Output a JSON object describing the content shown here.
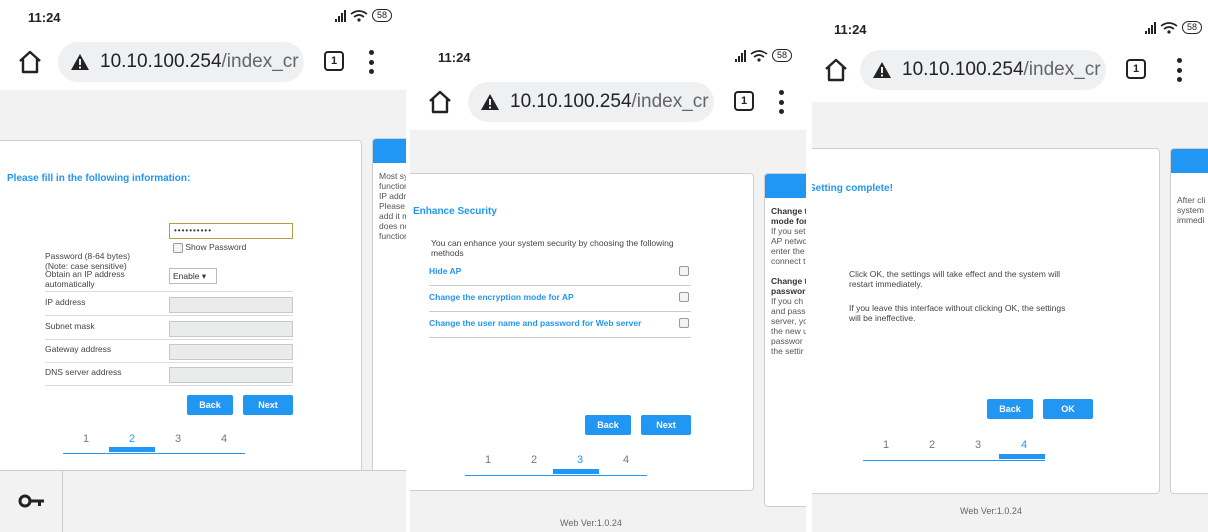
{
  "status": {
    "time": "11:24",
    "battery": "58"
  },
  "browser": {
    "url_host": "10.10.100.254",
    "url_rest": "/index_cr",
    "tab_count": "1"
  },
  "footer": {
    "version": "Web Ver:1.0.24"
  },
  "step2": {
    "title": "Please fill in the following information:",
    "password_label": "Password (8-64 bytes)",
    "password_note": "(Note: case sensitive)",
    "password_value": "••••••••••",
    "show_password": "Show Password",
    "dhcp_label": "Obtain an IP address",
    "dhcp_label2": "automatically",
    "dhcp_value": "Enable ▾",
    "ip_label": "IP address",
    "subnet_label": "Subnet mask",
    "gateway_label": "Gateway address",
    "dns_label": "DNS server address",
    "back": "Back",
    "next": "Next",
    "side": [
      "Most sys",
      "function",
      "IP addre",
      "Please s",
      "add it ma",
      "does not",
      "function."
    ]
  },
  "step3": {
    "title": "Enhance Security",
    "intro": "You can enhance your system security by choosing the following",
    "intro2": "methods",
    "options": [
      "Hide AP",
      "Change the encryption mode for AP",
      "Change the user name and password for Web server"
    ],
    "back": "Back",
    "next": "Next",
    "side": [
      "Change t",
      "mode for",
      "If you set",
      "AP netwo",
      "enter the",
      "connect t",
      "",
      "Change t",
      "passwor",
      "If you ch",
      "and pass",
      "server, yo",
      "the new u",
      "passwor",
      "the settir"
    ]
  },
  "step4": {
    "title": "Setting complete!",
    "msg1": "Click OK, the settings will take effect and the system will",
    "msg1b": "restart immediately.",
    "msg2": "If you leave this interface without clicking OK, the settings",
    "msg2b": "will be ineffective.",
    "back": "Back",
    "ok": "OK",
    "side": [
      "After cli",
      "system",
      "immedi"
    ]
  },
  "steps": [
    "1",
    "2",
    "3",
    "4"
  ]
}
